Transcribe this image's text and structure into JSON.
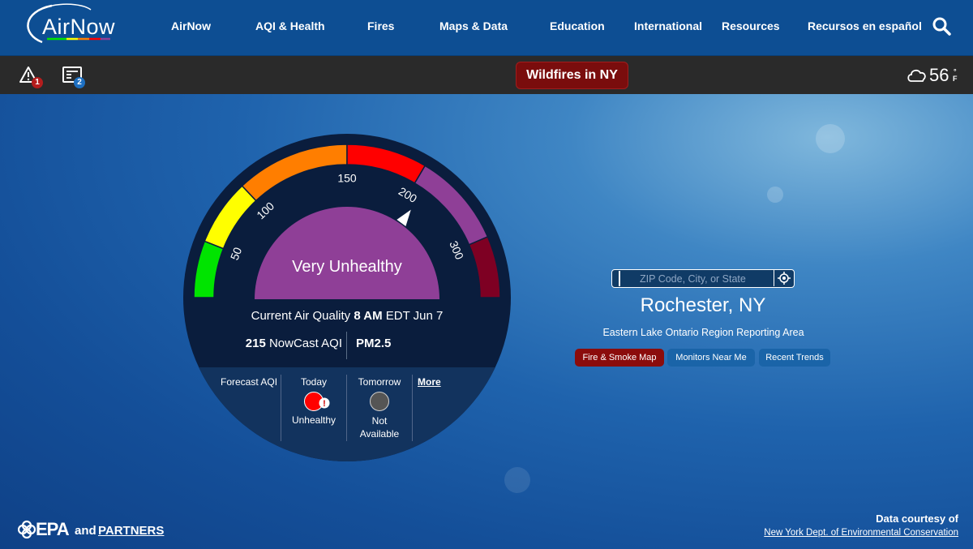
{
  "logo": {
    "text": "AirNow"
  },
  "nav": {
    "items": [
      {
        "label": "AirNow"
      },
      {
        "label": "AQI & Health"
      },
      {
        "label": "Fires"
      },
      {
        "label": "Maps & Data"
      },
      {
        "label": "Education"
      },
      {
        "label": "International"
      },
      {
        "label": "Resources"
      },
      {
        "label": "Recursos en español"
      }
    ],
    "search_icon": "search-icon"
  },
  "alerts": {
    "warning_count": "1",
    "news_count": "2",
    "wildfire_button": "Wildfires in NY",
    "weather": {
      "icon": "cloud-icon",
      "temp": "56",
      "unit_degree": "°",
      "unit": "F"
    }
  },
  "dial": {
    "category": "Very Unhealthy",
    "ticks": [
      "50",
      "100",
      "150",
      "200",
      "300"
    ],
    "aqi_value": 215,
    "segment_colors": [
      "#00e400",
      "#ffff00",
      "#ff7e00",
      "#ff0000",
      "#8f3f97",
      "#7e0023"
    ],
    "current_prefix": "Current Air Quality",
    "current_time": "8 AM",
    "current_suffix": "EDT Jun 7",
    "nowcast_value": "215",
    "nowcast_label": "NowCast AQI",
    "pollutant": "PM2.5",
    "forecast_label": "Forecast AQI",
    "forecast": [
      {
        "day": "Today",
        "status": "Unhealthy",
        "color": "#ff0000"
      },
      {
        "day": "Tomorrow",
        "status": "Not Available",
        "color": "#555555"
      }
    ],
    "more_link": "More"
  },
  "location": {
    "search_placeholder": "ZIP Code, City, or State",
    "city": "Rochester, NY",
    "region": "Eastern Lake Ontario Region Reporting Area",
    "buttons": [
      {
        "label": "Fire & Smoke Map",
        "color": "#8b0c0c"
      },
      {
        "label": "Monitors Near Me",
        "color": "#1a64a8"
      },
      {
        "label": "Recent Trends",
        "color": "#1a64a8"
      }
    ]
  },
  "footer": {
    "epa": "EPA",
    "and": "and",
    "partners": "PARTNERS",
    "courtesy": "Data courtesy of",
    "courtesy_link": "New York Dept. of Environmental Conservation"
  }
}
